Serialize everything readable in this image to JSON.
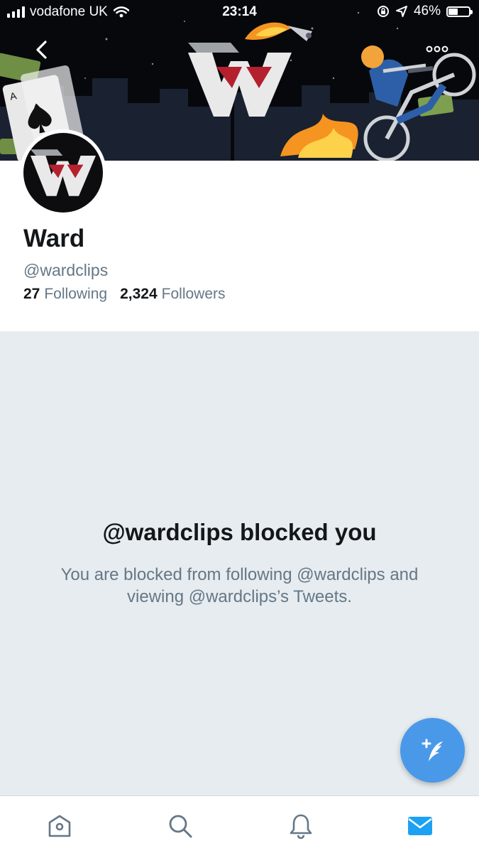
{
  "status_bar": {
    "carrier": "vodafone UK",
    "time": "23:14",
    "battery_percent_label": "46%",
    "battery_level": 0.46
  },
  "profile": {
    "name": "Ward",
    "handle": "@wardclips",
    "following_count": "27",
    "following_label": "Following",
    "followers_count": "2,324",
    "followers_label": "Followers"
  },
  "blocked": {
    "title": "@wardclips blocked you",
    "message": "You are blocked from following @wardclips and viewing @wardclips’s Tweets."
  },
  "colors": {
    "accent": "#1da1f2",
    "fab": "#4a99e9",
    "brand_red": "#b5202e",
    "background": "#e6ecf0",
    "text_primary": "#14171a",
    "text_secondary": "#657786"
  },
  "icons": {
    "back": "chevron-left-icon",
    "more": "more-dots-icon",
    "compose": "compose-feather-icon",
    "tabs": [
      "home-icon",
      "search-icon",
      "bell-icon",
      "mail-icon"
    ]
  },
  "active_tab": "messages"
}
